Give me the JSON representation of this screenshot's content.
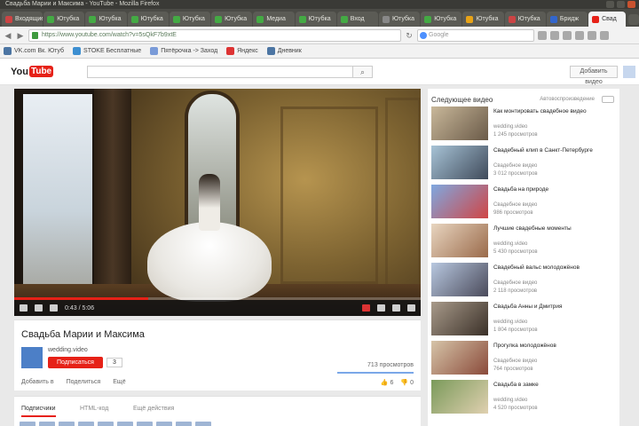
{
  "window": {
    "title": "Свадьба Марии и Максима - YouTube - Mozilla Firefox"
  },
  "tabs": [
    {
      "label": "Входящие",
      "color": "#c44"
    },
    {
      "label": "Ютубка",
      "color": "#4a4"
    },
    {
      "label": "Ютубка",
      "color": "#4a4"
    },
    {
      "label": "Ютубка",
      "color": "#4a4"
    },
    {
      "label": "Ютубка",
      "color": "#4a4"
    },
    {
      "label": "Ютубка",
      "color": "#4a4"
    },
    {
      "label": "Медиа",
      "color": "#4a4"
    },
    {
      "label": "Ютубка",
      "color": "#4a4"
    },
    {
      "label": "Вход",
      "color": "#4a4"
    },
    {
      "label": "Ютубка",
      "color": "#888"
    },
    {
      "label": "Ютубка",
      "color": "#4a4"
    },
    {
      "label": "Ютубка",
      "color": "#e8a317"
    },
    {
      "label": "Ютубка",
      "color": "#c44"
    },
    {
      "label": "Бридж",
      "color": "#36c"
    },
    {
      "label": "Свад",
      "color": "#e62117",
      "active": true
    }
  ],
  "nav": {
    "url": "https://www.youtube.com/watch?v=5sQkF7b9xtE",
    "search_placeholder": "Google"
  },
  "bookmarks": [
    {
      "label": "VK.com Вк. Ютуб",
      "color": "#4c75a3"
    },
    {
      "label": "STOKE Бесплатные",
      "color": "#3d8fd1"
    },
    {
      "label": "Пятёрочка -> Заход",
      "color": "#7a9bd8"
    },
    {
      "label": "Яндекс",
      "color": "#d33"
    },
    {
      "label": "Дневник",
      "color": "#4c75a3"
    }
  ],
  "youtube": {
    "logo_you": "You",
    "logo_tube": "Tube",
    "upload_label": "Добавить видео"
  },
  "player": {
    "time": "0:43 / 5:06",
    "progress": 0.33
  },
  "video": {
    "title": "Свадьба Марии и Максима",
    "channel": "wedding.video",
    "subscribe": "Подписаться",
    "sub_count": "3",
    "views": "713 просмотров",
    "actions": [
      "Добавить в",
      "Поделиться",
      "Ещё"
    ],
    "likes": "6",
    "dislikes": "0"
  },
  "detail_tabs": [
    "Подписчики",
    "HTML-код",
    "Ещё действия"
  ],
  "sidebar": {
    "heading": "Следующее видео",
    "autoplay": "Автовоспроизведение",
    "items": [
      {
        "title": "Как монтировать свадебное видео",
        "channel": "wedding.video",
        "views": "1 245 просмотров",
        "c1": "#c9b89a",
        "c2": "#6a5a48"
      },
      {
        "title": "Свадебный клип в Санкт-Петербурге",
        "channel": "Свадебное видео",
        "views": "3 012 просмотров",
        "c1": "#a7c3d6",
        "c2": "#3f4a5a"
      },
      {
        "title": "Свадьба на природе",
        "channel": "Свадебное видео",
        "views": "986 просмотров",
        "c1": "#7fa8e0",
        "c2": "#d04545"
      },
      {
        "title": "Лучшие свадебные моменты",
        "channel": "wedding.video",
        "views": "5 430 просмотров",
        "c1": "#e8d5c0",
        "c2": "#9a6a4a"
      },
      {
        "title": "Свадебный вальс молодожёнов",
        "channel": "Свадебное видео",
        "views": "2 118 просмотров",
        "c1": "#b8c8e0",
        "c2": "#4a4a5a"
      },
      {
        "title": "Свадьба Анны и Дмитрия",
        "channel": "wedding.video",
        "views": "1 804 просмотров",
        "c1": "#a89a8a",
        "c2": "#3a3028"
      },
      {
        "title": "Прогулка молодожёнов",
        "channel": "Свадебное видео",
        "views": "764 просмотров",
        "c1": "#d6c4a8",
        "c2": "#8a4a3a"
      },
      {
        "title": "Свадьба в замке",
        "channel": "wedding.video",
        "views": "4 520 просмотров",
        "c1": "#7a9a5a",
        "c2": "#e0d0b0"
      }
    ]
  }
}
